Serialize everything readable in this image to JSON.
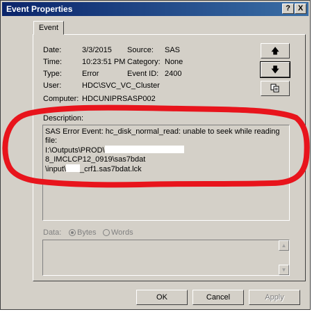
{
  "window": {
    "title": "Event Properties",
    "help_label": "?",
    "close_label": "X"
  },
  "tab": {
    "label": "Event"
  },
  "fields": {
    "date_label": "Date:",
    "date_value": "3/3/2015",
    "source_label": "Source:",
    "source_value": "SAS",
    "time_label": "Time:",
    "time_value": "10:23:51 PM",
    "category_label": "Category:",
    "category_value": "None",
    "type_label": "Type:",
    "type_value": "Error",
    "eventid_label": "Event ID:",
    "eventid_value": "2400",
    "user_label": "User:",
    "user_value": "HDC\\SVC_VC_Cluster",
    "computer_label": "Computer:",
    "computer_value": "HDCUNIPRSASP002"
  },
  "nav": {
    "up_icon": "arrow-up-icon",
    "down_icon": "arrow-down-icon",
    "copy_icon": "copy-icon"
  },
  "description": {
    "label": "Description:",
    "line1": "SAS Error Event: hc_disk_normal_read: unable to seek while reading file:",
    "line2a": "I:\\Outputs\\PROD\\",
    "line2b": "8_IMCLCP12_0919\\sas7bdat",
    "line3a": "\\input\\",
    "line3b": "_crf1.sas7bdat.lck"
  },
  "data": {
    "label": "Data:",
    "bytes_label": "Bytes",
    "words_label": "Words",
    "selected": "Bytes"
  },
  "buttons": {
    "ok": "OK",
    "cancel": "Cancel",
    "apply": "Apply"
  },
  "colors": {
    "annotation": "#e8141c",
    "titlebar": "#0a246a"
  }
}
